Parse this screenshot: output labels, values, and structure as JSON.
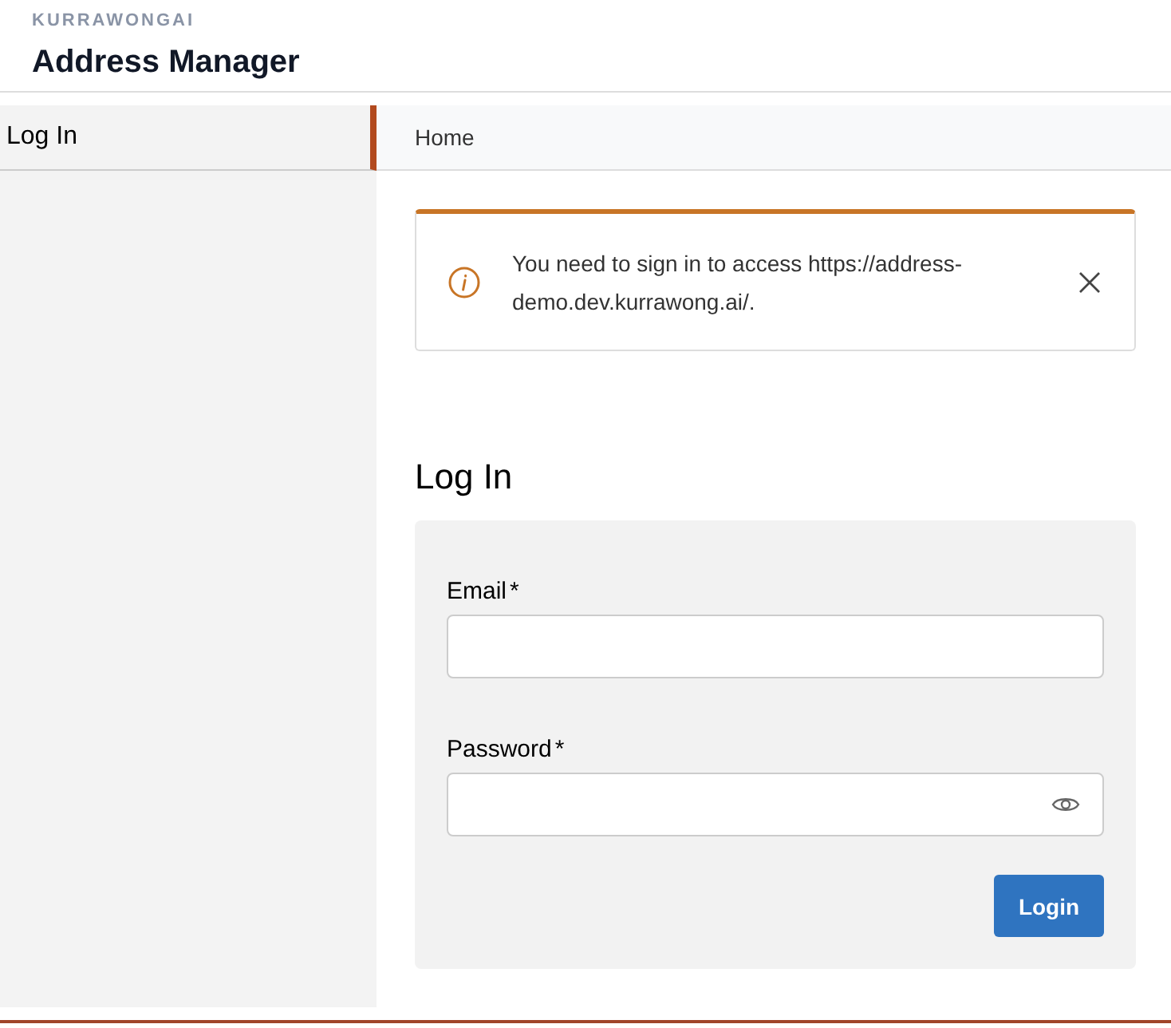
{
  "header": {
    "brand": "KURRAWONGAI",
    "title": "Address Manager"
  },
  "sidebar": {
    "items": [
      {
        "label": "Log In",
        "selected": true
      }
    ]
  },
  "breadcrumbs": [
    "Home"
  ],
  "alert": {
    "message": "You need to sign in to access https://address-demo.dev.kurrawong.ai/."
  },
  "form": {
    "heading": "Log In",
    "fields": [
      {
        "label": "Email",
        "required_mark": "*",
        "kind": "text"
      },
      {
        "label": "Password",
        "required_mark": "*",
        "kind": "password"
      }
    ],
    "submit": "Login"
  }
}
